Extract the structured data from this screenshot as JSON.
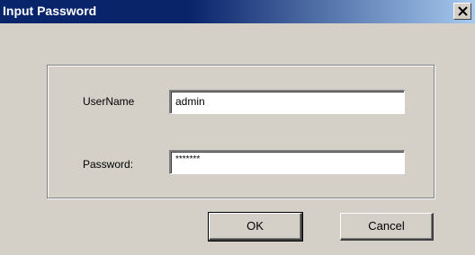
{
  "window": {
    "title": "Input Password",
    "close_icon": "close-icon"
  },
  "form": {
    "username_label": "UserName",
    "username_value": "admin",
    "password_label": "Password:",
    "password_value": "*******"
  },
  "buttons": {
    "ok_label": "OK",
    "cancel_label": "Cancel"
  },
  "colors": {
    "title_bar_start": "#08246b",
    "title_bar_end": "#a6caf0",
    "dialog_face": "#d4d0c8"
  }
}
